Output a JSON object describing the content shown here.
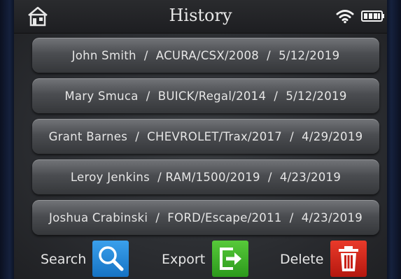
{
  "header": {
    "title": "History",
    "icons": [
      "home-icon",
      "wifi-icon",
      "battery-icon"
    ]
  },
  "history": {
    "entries": [
      "John Smith  /  ACURA/CSX/2008  /  5/12/2019",
      "Mary Smuca  /  BUICK/Regal/2014  /  5/12/2019",
      "Grant Barnes  /  CHEVROLET/Trax/2017  /  4/29/2019",
      "Leroy Jenkins  / RAM/1500/2019  /  4/23/2019",
      "Joshua Crabinski  /  FORD/Escape/2011  /  4/23/2019"
    ]
  },
  "toolbar": {
    "search_label": "Search",
    "export_label": "Export",
    "delete_label": "Delete",
    "icons": [
      "search-icon",
      "export-icon",
      "trash-icon"
    ]
  },
  "colors": {
    "search_button": "#1f86d6",
    "export_button": "#3bb02a",
    "delete_button": "#d4251a"
  }
}
